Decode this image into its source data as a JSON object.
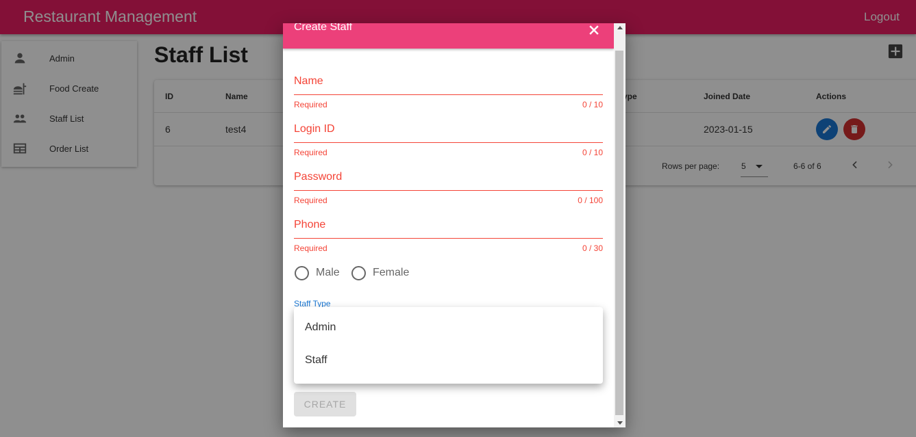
{
  "app": {
    "title": "Restaurant Management",
    "logout_label": "Logout",
    "primary_color": "#e91e63"
  },
  "sidebar": {
    "items": [
      {
        "label": "Admin",
        "icon": "person-icon"
      },
      {
        "label": "Food Create",
        "icon": "food-icon"
      },
      {
        "label": "Staff List",
        "icon": "people-icon"
      },
      {
        "label": "Order List",
        "icon": "table-icon"
      }
    ]
  },
  "main": {
    "page_title": "Staff List",
    "add_icon": "add-box-icon",
    "table": {
      "columns": [
        "ID",
        "Name",
        "ype",
        "Joined Date",
        "Actions"
      ],
      "rows": [
        {
          "id": "6",
          "name": "test4",
          "joined_date": "2023-01-15"
        }
      ],
      "edit_color": "#1976d2",
      "delete_color": "#d32f2f"
    },
    "pagination": {
      "rows_per_page_label": "Rows per page:",
      "rows_per_page_value": "5",
      "range_label": "6-6 of 6"
    }
  },
  "dialog": {
    "title": "Create Staff",
    "header_color": "#ec407a",
    "fields": [
      {
        "label": "Name",
        "helper": "Required",
        "counter": "0 / 10"
      },
      {
        "label": "Login ID",
        "helper": "Required",
        "counter": "0 / 10"
      },
      {
        "label": "Password",
        "helper": "Required",
        "counter": "0 / 100"
      },
      {
        "label": "Phone",
        "helper": "Required",
        "counter": "0 / 30"
      }
    ],
    "gender_options": [
      "Male",
      "Female"
    ],
    "staff_type_label": "Staff Type",
    "staff_type_options": [
      "Admin",
      "Staff"
    ],
    "create_label": "CREATE",
    "error_color": "#f44336"
  }
}
